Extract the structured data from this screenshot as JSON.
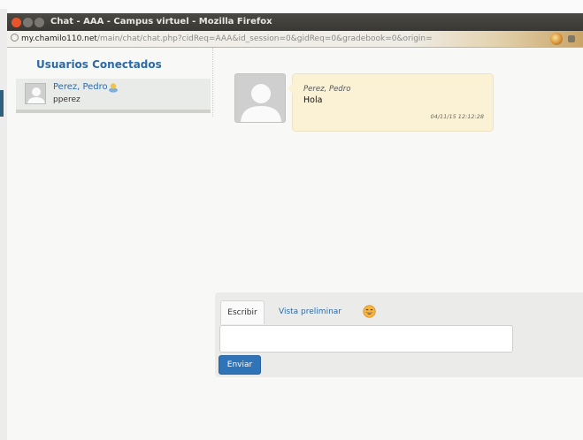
{
  "window": {
    "title": "Chat - AAA - Campus virtuel - Mozilla Firefox"
  },
  "browser": {
    "url_host": "my.chamilo110.net",
    "url_path": "/main/chat/chat.php?cidReq=AAA&id_session=0&gidReq=0&gradebook=0&origin="
  },
  "sidebar": {
    "title": "Usuarios Conectados",
    "users": [
      {
        "name": "Perez, Pedro",
        "login": "pperez"
      }
    ]
  },
  "messages": [
    {
      "author": "Perez, Pedro",
      "text": "Hola",
      "time": "04/11/15 12:12:28"
    }
  ],
  "composer": {
    "tab_write": "Escribir",
    "tab_preview": "Vista preliminar",
    "send_label": "Enviar",
    "input_value": ""
  },
  "icons": [
    "globe-icon",
    "user-status-icon",
    "emoji-icon",
    "avatar"
  ],
  "colors": {
    "link": "#2a6aa8",
    "bubble": "#fbf2d6",
    "send_button": "#2f73b8",
    "close_button": "#e9552a"
  }
}
